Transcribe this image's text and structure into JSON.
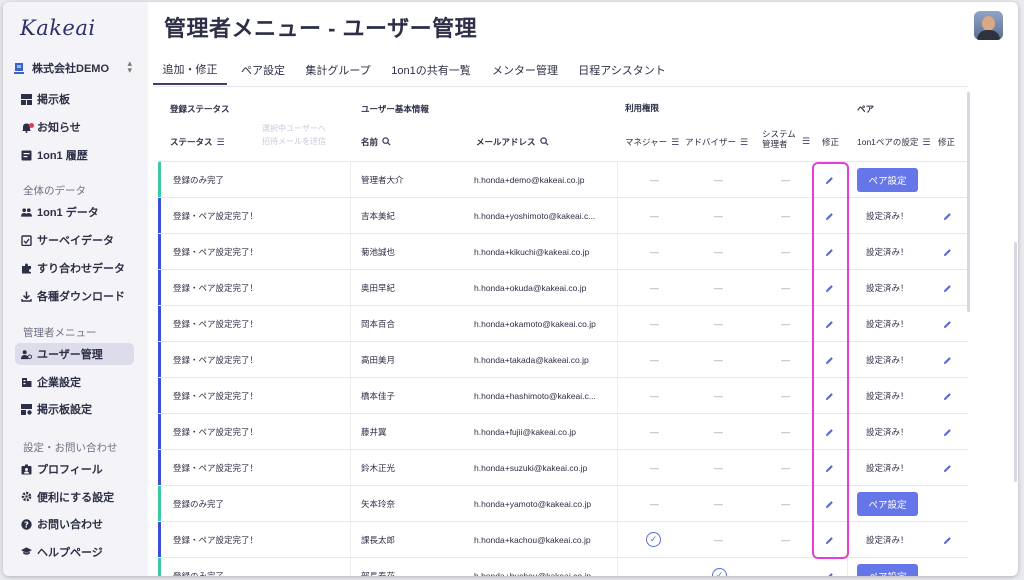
{
  "app": {
    "logo": "Kakeai",
    "company": "株式会社DEMO"
  },
  "sidebar": {
    "top_items": [
      {
        "label": "掲示板",
        "icon": "board-icon"
      },
      {
        "label": "お知らせ",
        "icon": "bell-icon"
      },
      {
        "label": "1on1 履歴",
        "icon": "history-icon"
      }
    ],
    "section_data": "全体のデータ",
    "data_items": [
      {
        "label": "1on1 データ",
        "icon": "people-icon"
      },
      {
        "label": "サーベイデータ",
        "icon": "survey-icon"
      },
      {
        "label": "すり合わせデータ",
        "icon": "puzzle-icon"
      },
      {
        "label": "各種ダウンロード",
        "icon": "download-icon"
      }
    ],
    "section_admin": "管理者メニュー",
    "admin_items": [
      {
        "label": "ユーザー管理",
        "icon": "user-manage-icon",
        "active": true
      },
      {
        "label": "企業設定",
        "icon": "building-icon"
      },
      {
        "label": "掲示板設定",
        "icon": "board-settings-icon"
      }
    ],
    "section_settings": "設定・お問い合わせ",
    "settings_items": [
      {
        "label": "プロフィール",
        "icon": "profile-icon"
      },
      {
        "label": "便利にする設定",
        "icon": "gear-icon"
      },
      {
        "label": "お問い合わせ",
        "icon": "help-icon"
      },
      {
        "label": "ヘルプページ",
        "icon": "graduation-cap-icon"
      }
    ]
  },
  "header": {
    "title": "管理者メニュー - ユーザー管理"
  },
  "tabs": [
    {
      "label": "追加・修正",
      "active": true
    },
    {
      "label": "ペア設定"
    },
    {
      "label": "集計グループ"
    },
    {
      "label": "1on1の共有一覧"
    },
    {
      "label": "メンター管理"
    },
    {
      "label": "日程アシスタント"
    }
  ],
  "table": {
    "groups": {
      "registration": "登録ステータス",
      "user_info": "ユーザー基本情報",
      "permissions": "利用権限",
      "pair": "ペア"
    },
    "faint_text": [
      "選択中ユーザーへ",
      "招待メールを送信"
    ],
    "columns": {
      "status": "ステータス",
      "name": "名前",
      "email": "メールアドレス",
      "manager": "マネジャー",
      "advisor": "アドバイザー",
      "sysadmin": "システム管理者",
      "edit": "修正",
      "pair_setting": "1on1ペアの設定",
      "pair_edit": "修正"
    },
    "dash": "—",
    "rows": [
      {
        "status": "登録のみ完了",
        "name": "管理者大介",
        "email": "h.honda+demo@kakeai.co.jp",
        "manager": "—",
        "advisor": "—",
        "sysadmin": "—",
        "pair": "ペア設定",
        "pair_type": "button",
        "status_color": "#3cc9a0"
      },
      {
        "status": "登録・ペア設定完了！",
        "name": "吉本美紀",
        "email": "h.honda+yoshimoto@kakeai.c...",
        "manager": "—",
        "advisor": "—",
        "sysadmin": "—",
        "pair": "設定済み！",
        "pair_type": "text",
        "status_color": "#3a4fd9"
      },
      {
        "status": "登録・ペア設定完了！",
        "name": "菊池誠也",
        "email": "h.honda+kikuchi@kakeai.co.jp",
        "manager": "—",
        "advisor": "—",
        "sysadmin": "—",
        "pair": "設定済み！",
        "pair_type": "text",
        "status_color": "#3a4fd9"
      },
      {
        "status": "登録・ペア設定完了！",
        "name": "奥田早紀",
        "email": "h.honda+okuda@kakeai.co.jp",
        "manager": "—",
        "advisor": "—",
        "sysadmin": "—",
        "pair": "設定済み！",
        "pair_type": "text",
        "status_color": "#3a4fd9"
      },
      {
        "status": "登録・ペア設定完了！",
        "name": "岡本百合",
        "email": "h.honda+okamoto@kakeai.co.jp",
        "manager": "—",
        "advisor": "—",
        "sysadmin": "—",
        "pair": "設定済み！",
        "pair_type": "text",
        "status_color": "#3a4fd9"
      },
      {
        "status": "登録・ペア設定完了！",
        "name": "高田美月",
        "email": "h.honda+takada@kakeai.co.jp",
        "manager": "—",
        "advisor": "—",
        "sysadmin": "—",
        "pair": "設定済み！",
        "pair_type": "text",
        "status_color": "#3a4fd9"
      },
      {
        "status": "登録・ペア設定完了！",
        "name": "橋本佳子",
        "email": "h.honda+hashimoto@kakeai.c...",
        "manager": "—",
        "advisor": "—",
        "sysadmin": "—",
        "pair": "設定済み！",
        "pair_type": "text",
        "status_color": "#3a4fd9"
      },
      {
        "status": "登録・ペア設定完了！",
        "name": "藤井翼",
        "email": "h.honda+fujii@kakeai.co.jp",
        "manager": "—",
        "advisor": "—",
        "sysadmin": "—",
        "pair": "設定済み！",
        "pair_type": "text",
        "status_color": "#3a4fd9"
      },
      {
        "status": "登録・ペア設定完了！",
        "name": "鈴木正光",
        "email": "h.honda+suzuki@kakeai.co.jp",
        "manager": "—",
        "advisor": "—",
        "sysadmin": "—",
        "pair": "設定済み！",
        "pair_type": "text",
        "status_color": "#3a4fd9"
      },
      {
        "status": "登録のみ完了",
        "name": "矢本玲奈",
        "email": "h.honda+yamoto@kakeai.co.jp",
        "manager": "—",
        "advisor": "—",
        "sysadmin": "—",
        "pair": "ペア設定",
        "pair_type": "button",
        "status_color": "#3cc9a0"
      },
      {
        "status": "登録・ペア設定完了！",
        "name": "課長太郎",
        "email": "h.honda+kachou@kakeai.co.jp",
        "manager": "check",
        "advisor": "—",
        "sysadmin": "—",
        "pair": "設定済み！",
        "pair_type": "text",
        "status_color": "#3a4fd9"
      },
      {
        "status": "登録のみ完了",
        "name": "部長春花",
        "email": "h.honda+buchou@kakeai.co.jp",
        "manager": "—",
        "advisor": "check",
        "sysadmin": "—",
        "pair": "ペア設定",
        "pair_type": "button",
        "status_color": "#3cc9a0"
      }
    ]
  },
  "colors": {
    "accent": "#6476e8",
    "highlight": "#e63fd8",
    "registered_only": "#3cc9a0",
    "complete": "#3a4fd9"
  }
}
